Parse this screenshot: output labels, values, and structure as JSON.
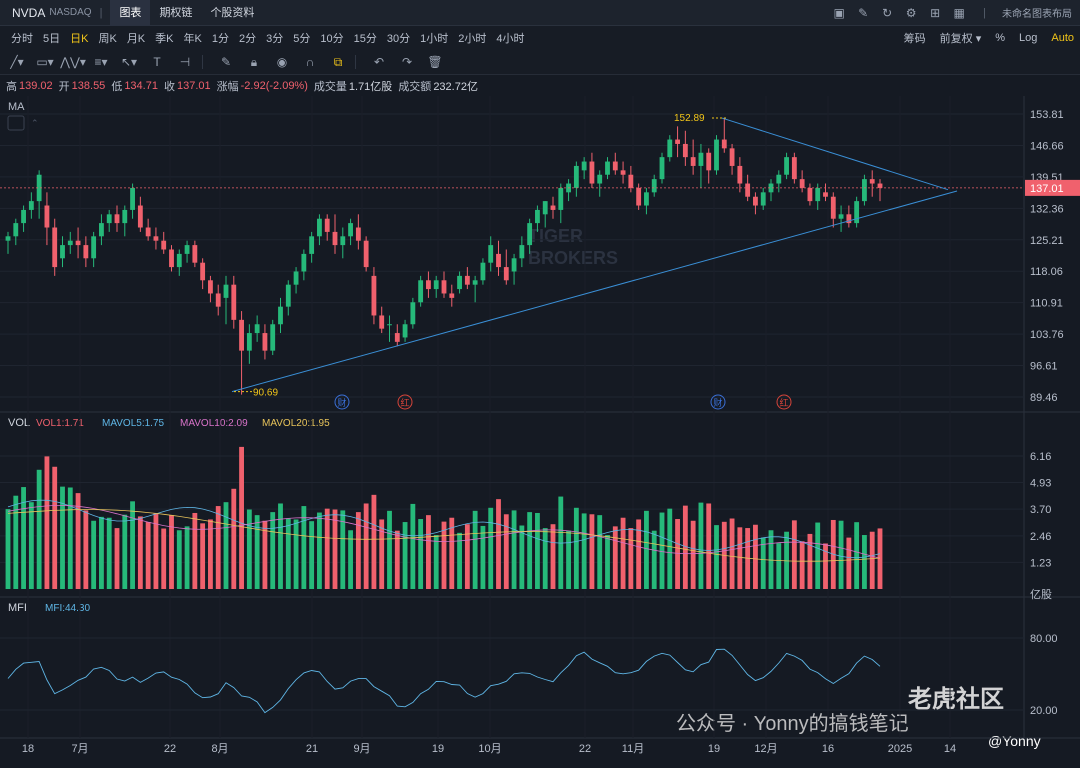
{
  "header": {
    "symbol": "NVDA",
    "exchange": "NASDAQ",
    "tabs": [
      "图表",
      "期权链",
      "个股资料"
    ],
    "active_tab": "图表",
    "layout_name": "未命名图表布局"
  },
  "periods": [
    "分时",
    "5日",
    "日K",
    "周K",
    "月K",
    "季K",
    "年K",
    "1分",
    "2分",
    "3分",
    "5分",
    "10分",
    "15分",
    "30分",
    "1小时",
    "2小时",
    "4小时"
  ],
  "active_period": "日K",
  "options": [
    "筹码",
    "前复权",
    "%",
    "Log",
    "Auto"
  ],
  "quote": {
    "high_label": "高",
    "high": "139.02",
    "open_label": "开",
    "open": "138.55",
    "low_label": "低",
    "low": "134.71",
    "close_label": "收",
    "close": "137.01",
    "change_label": "涨幅",
    "change": "-2.92(-2.09%)",
    "volume_label": "成交量",
    "volume": "1.71亿股",
    "turnover_label": "成交额",
    "turnover": "232.72亿"
  },
  "ma_label": "MA",
  "price_axis": [
    "153.81",
    "146.66",
    "139.51",
    "132.36",
    "125.21",
    "118.06",
    "110.91",
    "103.76",
    "96.61",
    "89.46"
  ],
  "last_price": "137.01",
  "annotations": {
    "high": "152.89",
    "low": "90.69"
  },
  "event_markers": [
    "财",
    "红",
    "财",
    "红"
  ],
  "watermark": [
    "TIGER",
    "BROKERS"
  ],
  "vol": {
    "title": "VOL",
    "vol1": "VOL1:1.71",
    "mavol5": "MAVOL5:1.75",
    "mavol10": "MAVOL10:2.09",
    "mavol20": "MAVOL20:1.95",
    "axis": [
      "6.16",
      "4.93",
      "3.70",
      "2.46",
      "1.23",
      "亿股"
    ]
  },
  "mfi": {
    "title": "MFI",
    "value": "MFI:44.30",
    "axis": [
      "80.00",
      "20.00"
    ]
  },
  "x_axis": [
    "18",
    "7月",
    "22",
    "8月",
    "21",
    "9月",
    "19",
    "10月",
    "22",
    "11月",
    "19",
    "12月",
    "16",
    "2025",
    "14"
  ],
  "overlay_text": {
    "brand": "老虎社区",
    "wechat": "公众号 · Yonny的搞钱笔记",
    "handle": "@Yonny"
  },
  "colors": {
    "up": "#26b97a",
    "down": "#f0616d",
    "accent": "#f0c419",
    "trend": "#3a8fd6",
    "ma5": "#5fb6e6",
    "ma10": "#d873c9",
    "ma20": "#e7c35a"
  },
  "chart_data": {
    "type": "candlestick",
    "candles": [
      [
        125,
        127,
        122,
        126
      ],
      [
        126,
        130,
        124,
        129
      ],
      [
        129,
        133,
        127,
        132
      ],
      [
        132,
        136,
        130,
        134
      ],
      [
        134,
        141,
        130,
        140
      ],
      [
        133,
        136,
        124,
        128
      ],
      [
        128,
        130,
        117,
        119
      ],
      [
        121,
        126,
        119,
        124
      ],
      [
        124,
        127,
        122,
        125
      ],
      [
        125,
        128,
        121,
        124
      ],
      [
        124,
        126,
        119,
        121
      ],
      [
        121,
        127,
        119,
        126
      ],
      [
        126,
        131,
        124,
        129
      ],
      [
        129,
        132,
        127,
        131
      ],
      [
        131,
        133,
        127,
        129
      ],
      [
        129,
        133,
        126,
        132
      ],
      [
        132,
        138,
        130,
        137
      ],
      [
        133,
        135,
        127,
        128
      ],
      [
        128,
        130,
        125,
        126
      ],
      [
        126,
        128,
        123,
        125
      ],
      [
        125,
        127,
        122,
        123
      ],
      [
        123,
        124,
        118,
        119
      ],
      [
        119,
        123,
        117,
        122
      ],
      [
        122,
        125,
        120,
        124
      ],
      [
        124,
        125,
        119,
        120
      ],
      [
        120,
        121,
        114,
        116
      ],
      [
        116,
        117,
        111,
        113
      ],
      [
        113,
        115,
        108,
        110
      ],
      [
        112,
        117,
        106,
        115
      ],
      [
        115,
        117,
        105,
        107
      ],
      [
        107,
        109,
        90,
        100
      ],
      [
        100,
        106,
        97,
        104
      ],
      [
        104,
        108,
        102,
        106
      ],
      [
        104,
        106,
        98,
        100
      ],
      [
        100,
        107,
        99,
        106
      ],
      [
        106,
        112,
        104,
        110
      ],
      [
        110,
        116,
        108,
        115
      ],
      [
        115,
        119,
        113,
        118
      ],
      [
        118,
        123,
        116,
        122
      ],
      [
        122,
        127,
        120,
        126
      ],
      [
        126,
        131,
        124,
        130
      ],
      [
        130,
        131,
        125,
        127
      ],
      [
        127,
        131,
        122,
        124
      ],
      [
        124,
        128,
        121,
        126
      ],
      [
        126,
        130,
        124,
        129
      ],
      [
        128,
        131,
        123,
        125
      ],
      [
        125,
        126,
        118,
        119
      ],
      [
        117,
        119,
        106,
        108
      ],
      [
        108,
        110,
        104,
        105
      ],
      [
        106,
        108,
        102,
        106
      ],
      [
        104,
        106,
        101,
        102
      ],
      [
        103,
        107,
        102,
        106
      ],
      [
        106,
        112,
        105,
        111
      ],
      [
        111,
        117,
        110,
        116
      ],
      [
        116,
        118,
        112,
        114
      ],
      [
        114,
        117,
        112,
        116
      ],
      [
        116,
        118,
        112,
        113
      ],
      [
        113,
        115,
        110,
        112
      ],
      [
        114,
        118,
        113,
        117
      ],
      [
        117,
        119,
        114,
        115
      ],
      [
        115,
        117,
        111,
        116
      ],
      [
        116,
        121,
        115,
        120
      ],
      [
        120,
        126,
        118,
        124
      ],
      [
        122,
        125,
        117,
        119
      ],
      [
        119,
        123,
        115,
        116
      ],
      [
        118,
        122,
        115,
        121
      ],
      [
        121,
        126,
        119,
        124
      ],
      [
        124,
        130,
        122,
        129
      ],
      [
        129,
        133,
        127,
        132
      ],
      [
        131,
        134,
        128,
        134
      ],
      [
        133,
        135,
        130,
        132
      ],
      [
        132,
        138,
        129,
        137
      ],
      [
        136,
        139,
        134,
        138
      ],
      [
        137,
        143,
        135,
        142
      ],
      [
        141,
        144,
        139,
        143
      ],
      [
        143,
        145,
        137,
        138
      ],
      [
        138,
        141,
        135,
        140
      ],
      [
        140,
        144,
        139,
        143
      ],
      [
        143,
        145,
        140,
        141
      ],
      [
        141,
        143,
        138,
        140
      ],
      [
        140,
        142,
        136,
        137
      ],
      [
        137,
        138,
        132,
        133
      ],
      [
        133,
        137,
        131,
        136
      ],
      [
        136,
        140,
        135,
        139
      ],
      [
        139,
        145,
        138,
        144
      ],
      [
        144,
        149,
        143,
        148
      ],
      [
        148,
        151,
        144,
        147
      ],
      [
        147,
        150,
        142,
        144
      ],
      [
        144,
        148,
        140,
        142
      ],
      [
        142,
        147,
        137,
        145
      ],
      [
        145,
        146,
        138,
        141
      ],
      [
        141,
        149,
        140,
        148
      ],
      [
        148,
        153,
        145,
        146
      ],
      [
        146,
        147,
        140,
        142
      ],
      [
        142,
        144,
        136,
        138
      ],
      [
        138,
        140,
        134,
        135
      ],
      [
        135,
        136,
        131,
        133
      ],
      [
        133,
        137,
        132,
        136
      ],
      [
        136,
        139,
        134,
        138
      ],
      [
        138,
        141,
        136,
        140
      ],
      [
        140,
        145,
        139,
        144
      ],
      [
        144,
        145,
        138,
        139
      ],
      [
        139,
        141,
        136,
        137
      ],
      [
        137,
        138,
        133,
        134
      ],
      [
        134,
        138,
        132,
        137
      ],
      [
        136,
        138,
        134,
        135
      ],
      [
        135,
        136,
        128,
        130
      ],
      [
        130,
        133,
        127,
        131
      ],
      [
        131,
        133,
        128,
        129
      ],
      [
        129,
        135,
        128,
        134
      ],
      [
        134,
        140,
        133,
        139
      ],
      [
        139,
        141,
        135,
        138
      ],
      [
        138,
        139,
        134,
        137
      ]
    ],
    "volume_unit": "亿股",
    "mfi_levels": [
      80,
      20
    ]
  }
}
